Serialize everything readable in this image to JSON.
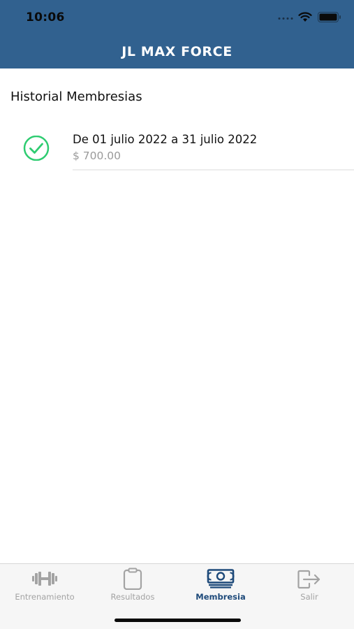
{
  "status_bar": {
    "time": "10:06"
  },
  "header": {
    "title": "JL MAX FORCE",
    "background": "#31618f"
  },
  "section": {
    "title": "Historial Membresias"
  },
  "memberships": [
    {
      "period": "De 01 julio 2022 a 31 julio 2022",
      "amount": "$ 700.00",
      "status_icon": "check-circle-icon",
      "status_color": "#2ecc71"
    }
  ],
  "tabs": [
    {
      "label": "Entrenamiento",
      "icon": "dumbbell-icon",
      "active": false
    },
    {
      "label": "Resultados",
      "icon": "clipboard-icon",
      "active": false
    },
    {
      "label": "Membresia",
      "icon": "money-icon",
      "active": true
    },
    {
      "label": "Salir",
      "icon": "logout-icon",
      "active": false
    }
  ],
  "colors": {
    "active_tab": "#1e4a7a",
    "inactive_tab": "#a3a3a3"
  }
}
